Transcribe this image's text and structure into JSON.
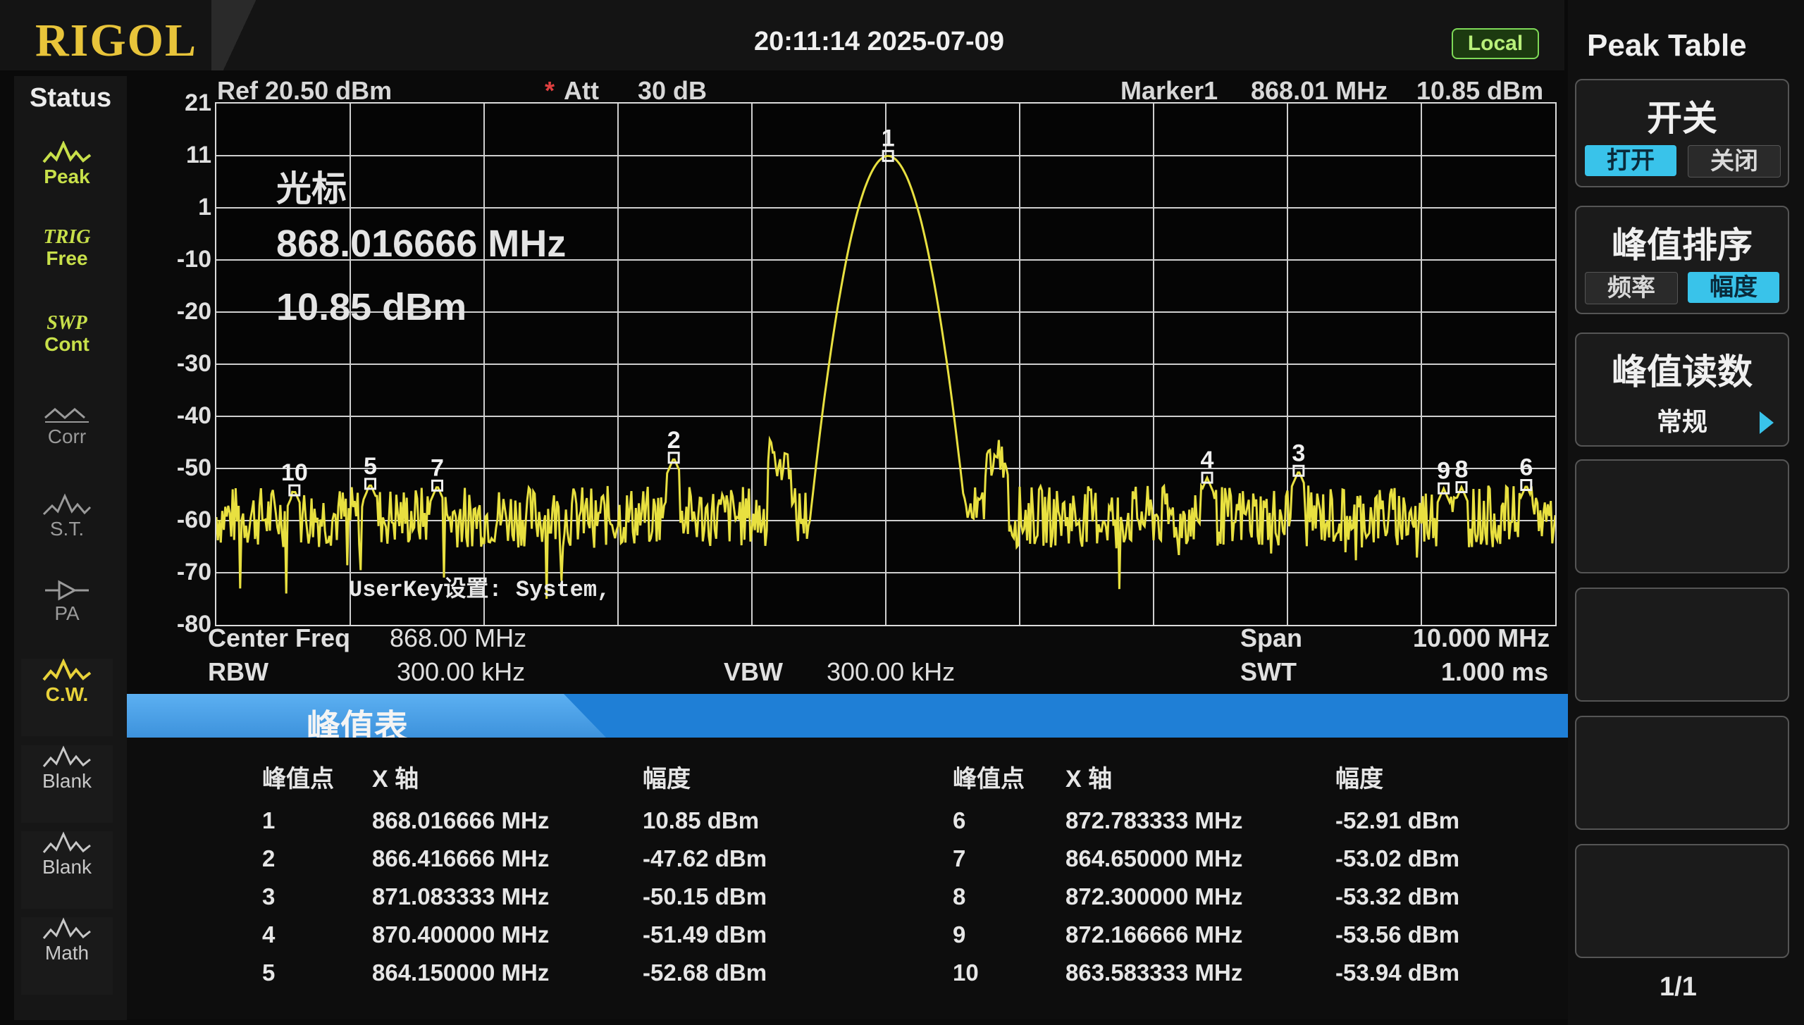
{
  "header": {
    "brand": "RIGOL",
    "datetime": "20:11:14 2025-07-09",
    "mode_badge": "Local"
  },
  "status": {
    "title": "Status",
    "items": [
      {
        "icon": "peak-wave-icon",
        "label": "Peak",
        "sub": "",
        "color": "#c8e04a"
      },
      {
        "icon": "",
        "label": "Free",
        "sub": "TRIG",
        "color": "#c8e04a"
      },
      {
        "icon": "",
        "label": "Cont",
        "sub": "SWP",
        "color": "#c8e04a"
      },
      {
        "icon": "corr-icon",
        "label": "Corr",
        "sub": "",
        "color": "#9a9a9a"
      },
      {
        "icon": "st-icon",
        "label": "S.T.",
        "sub": "",
        "color": "#9a9a9a"
      },
      {
        "icon": "pa-icon",
        "label": "PA",
        "sub": "",
        "color": "#9a9a9a"
      },
      {
        "icon": "cw-wave-icon",
        "label": "C.W.",
        "sub": "",
        "color": "#e8d23a"
      },
      {
        "icon": "blank-wave-icon",
        "label": "Blank",
        "sub": "",
        "color": "#c8c8c8"
      },
      {
        "icon": "blank-wave-icon",
        "label": "Blank",
        "sub": "",
        "color": "#c8c8c8"
      },
      {
        "icon": "math-wave-icon",
        "label": "Math",
        "sub": "",
        "color": "#c8c8c8"
      }
    ]
  },
  "info": {
    "ref": "Ref  20.50 dBm",
    "att_star": "*",
    "att_label": "Att",
    "att_value": "30 dB",
    "marker_name": "Marker1",
    "marker_freq": "868.01 MHz",
    "marker_amp": "10.85 dBm"
  },
  "marker_readout": {
    "title": "光标",
    "freq": "868.016666 MHz",
    "amp": "10.85 dBm"
  },
  "userkey_text": "UserKey设置:   System,",
  "chart_data": {
    "type": "line",
    "trace_color": "#e8e040",
    "xlim": [
      863.0,
      873.0
    ],
    "ylim": [
      -80,
      21
    ],
    "y_ticks": [
      "21",
      "11",
      "1",
      "-10",
      "-20",
      "-30",
      "-40",
      "-50",
      "-60",
      "-70",
      "-80"
    ],
    "grid": true,
    "markers": [
      {
        "label": "1",
        "x": 868.016666,
        "y": 10.85
      },
      {
        "label": "2",
        "x": 866.416666,
        "y": -47.62
      },
      {
        "label": "3",
        "x": 871.083333,
        "y": -50.15
      },
      {
        "label": "4",
        "x": 870.4,
        "y": -51.49
      },
      {
        "label": "5",
        "x": 864.15,
        "y": -52.68
      },
      {
        "label": "6",
        "x": 872.783333,
        "y": -52.91
      },
      {
        "label": "7",
        "x": 864.65,
        "y": -53.02
      },
      {
        "label": "8",
        "x": 872.3,
        "y": -53.32
      },
      {
        "label": "9",
        "x": 872.166666,
        "y": -53.56
      },
      {
        "label": "10",
        "x": 863.583333,
        "y": -53.94
      }
    ]
  },
  "params": {
    "center_label": "Center Freq",
    "center_value": "868.00 MHz",
    "span_label": "Span",
    "span_value": "10.000 MHz",
    "rbw_label": "RBW",
    "rbw_value": "300.00 kHz",
    "vbw_label": "VBW",
    "vbw_value": "300.00 kHz",
    "swt_label": "SWT",
    "swt_value": "1.000 ms"
  },
  "peak_table": {
    "title": "峰值表",
    "headers": {
      "point": "峰值点",
      "x": "X 轴",
      "amp": "幅度"
    },
    "left_rows": [
      {
        "n": "1",
        "x": "868.016666 MHz",
        "amp": "10.85 dBm"
      },
      {
        "n": "2",
        "x": "866.416666 MHz",
        "amp": "-47.62 dBm"
      },
      {
        "n": "3",
        "x": "871.083333 MHz",
        "amp": "-50.15 dBm"
      },
      {
        "n": "4",
        "x": "870.400000 MHz",
        "amp": "-51.49 dBm"
      },
      {
        "n": "5",
        "x": "864.150000 MHz",
        "amp": "-52.68 dBm"
      }
    ],
    "right_rows": [
      {
        "n": "6",
        "x": "872.783333 MHz",
        "amp": "-52.91 dBm"
      },
      {
        "n": "7",
        "x": "864.650000 MHz",
        "amp": "-53.02 dBm"
      },
      {
        "n": "8",
        "x": "872.300000 MHz",
        "amp": "-53.32 dBm"
      },
      {
        "n": "9",
        "x": "872.166666 MHz",
        "amp": "-53.56 dBm"
      },
      {
        "n": "10",
        "x": "863.583333 MHz",
        "amp": "-53.94 dBm"
      }
    ]
  },
  "softkeys": {
    "title": "Peak Table",
    "switch_label": "开关",
    "switch_on": "打开",
    "switch_off": "关闭",
    "sort_label": "峰值排序",
    "sort_freq": "频率",
    "sort_amp": "幅度",
    "readout_label": "峰值读数",
    "readout_value": "常规",
    "page": "1/1",
    "accent": "#39c3ea"
  }
}
